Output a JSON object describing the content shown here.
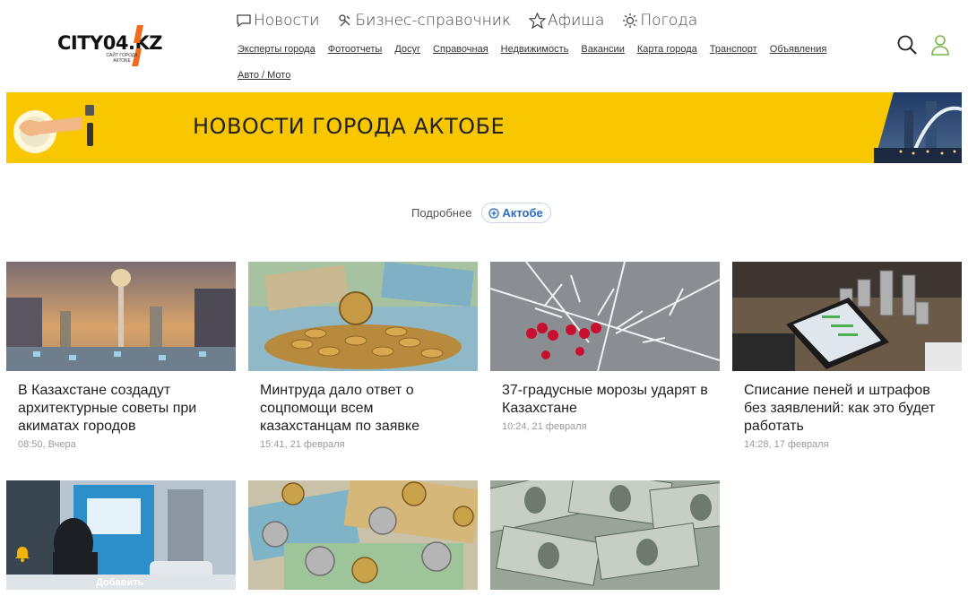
{
  "site": {
    "logo_text": "CITY04.KZ",
    "logo_sub": "сайт города актобе",
    "brand_color": "#f26b1d"
  },
  "main_nav": [
    {
      "label": "Новости",
      "icon": "chat-bubble-icon"
    },
    {
      "label": "Бизнес-справочник",
      "icon": "business-icon"
    },
    {
      "label": "Афиша",
      "icon": "star-icon"
    },
    {
      "label": "Погода",
      "icon": "sun-icon"
    }
  ],
  "sub_nav": [
    "Эксперты города",
    "Фотоотчеты",
    "Досуг",
    "Справочная",
    "Недвижимость",
    "Вакансии",
    "Карта города",
    "Транспорт",
    "Объявления",
    "Авто / Мото"
  ],
  "banner": {
    "title": "НОВОСТИ ГОРОДА АКТОБЕ",
    "bg_color": "#f9c700"
  },
  "filter": {
    "more_label": "Подробнее",
    "city_chip": "Актобе"
  },
  "cards": [
    {
      "title": "В Казахстане создадут архитектурные советы при акиматах городов",
      "date": "08:50, Вчера"
    },
    {
      "title": "Минтруда дало ответ о соцпомощи всем казахстанцам по заявке",
      "date": "15:41, 21 февраля"
    },
    {
      "title": "37-градусные морозы ударят в Казахстане",
      "date": "10:24, 21 февраля"
    },
    {
      "title": "Списание пеней и штрафов без заявлений: как это будет работать",
      "date": "14:28, 17 февраля"
    }
  ],
  "cards_row2": [
    {
      "badge": "Добавить"
    },
    {},
    {}
  ]
}
